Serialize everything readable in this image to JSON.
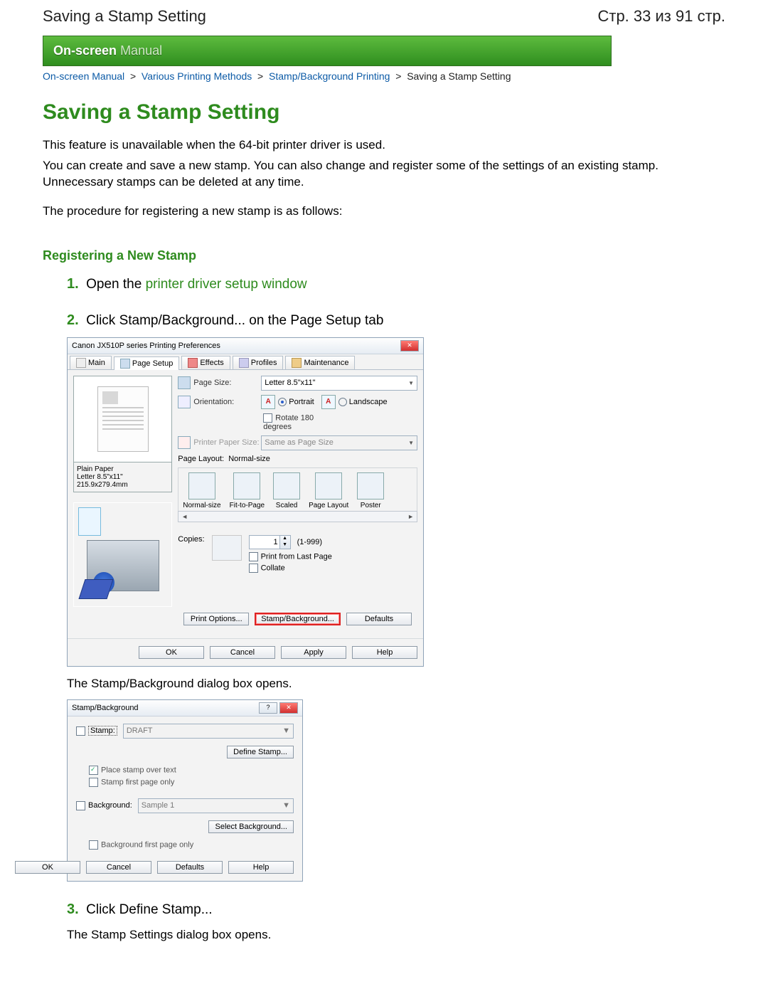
{
  "header": {
    "left": "Saving a Stamp Setting",
    "right": "Стр. 33 из 91 стр."
  },
  "banner": {
    "bold": "On-screen",
    "light": "Manual"
  },
  "breadcrumb": {
    "l1": "On-screen Manual",
    "l2": "Various Printing Methods",
    "l3": "Stamp/Background Printing",
    "current": "Saving a Stamp Setting"
  },
  "title": "Saving a Stamp Setting",
  "intro1": "This feature is unavailable when the 64-bit printer driver is used.",
  "intro2": "You can create and save a new stamp. You can also change and register some of the settings of an existing stamp. Unnecessary stamps can be deleted at any time.",
  "intro3": "The procedure for registering a new stamp is as follows:",
  "sectionHead": "Registering a New Stamp",
  "steps": {
    "s1": {
      "num": "1.",
      "textA": "Open the ",
      "link": "printer driver setup window"
    },
    "s2": {
      "num": "2.",
      "text": "Click Stamp/Background... on the Page Setup tab",
      "sub": "The Stamp/Background dialog box opens."
    },
    "s3": {
      "num": "3.",
      "text": "Click Define Stamp...",
      "sub": "The Stamp Settings dialog box opens."
    }
  },
  "bigDialog": {
    "title": "Canon JX510P series Printing Preferences",
    "tabs": {
      "main": "Main",
      "page": "Page Setup",
      "effects": "Effects",
      "profiles": "Profiles",
      "maint": "Maintenance"
    },
    "pageSize": {
      "label": "Page Size:",
      "value": "Letter 8.5\"x11\""
    },
    "orientation": {
      "label": "Orientation:",
      "portrait": "Portrait",
      "landscape": "Landscape",
      "rotate": "Rotate 180 degrees"
    },
    "printerPaper": {
      "label": "Printer Paper Size:",
      "value": "Same as Page Size"
    },
    "pageLayout": {
      "label": "Page Layout:",
      "value": "Normal-size"
    },
    "layoutItems": {
      "normal": "Normal-size",
      "fit": "Fit-to-Page",
      "scaled": "Scaled",
      "layout": "Page Layout",
      "poster": "Poster"
    },
    "copies": {
      "label": "Copies:",
      "value": "1",
      "range": "(1-999)",
      "fromLast": "Print from Last Page",
      "collate": "Collate"
    },
    "paperInfo": {
      "line1": "Plain Paper",
      "line2": "Letter 8.5\"x11\" 215.9x279.4mm"
    },
    "buttons": {
      "printOpt": "Print Options...",
      "stampBg": "Stamp/Background...",
      "defaults": "Defaults",
      "ok": "OK",
      "cancel": "Cancel",
      "apply": "Apply",
      "help": "Help"
    }
  },
  "smallDialog": {
    "title": "Stamp/Background",
    "stamp": {
      "label": "Stamp:",
      "value": "DRAFT",
      "define": "Define Stamp...",
      "overText": "Place stamp over text",
      "firstOnly": "Stamp first page only"
    },
    "background": {
      "label": "Background:",
      "value": "Sample 1",
      "select": "Select Background...",
      "firstOnly": "Background first page only"
    },
    "buttons": {
      "ok": "OK",
      "cancel": "Cancel",
      "defaults": "Defaults",
      "help": "Help"
    }
  }
}
